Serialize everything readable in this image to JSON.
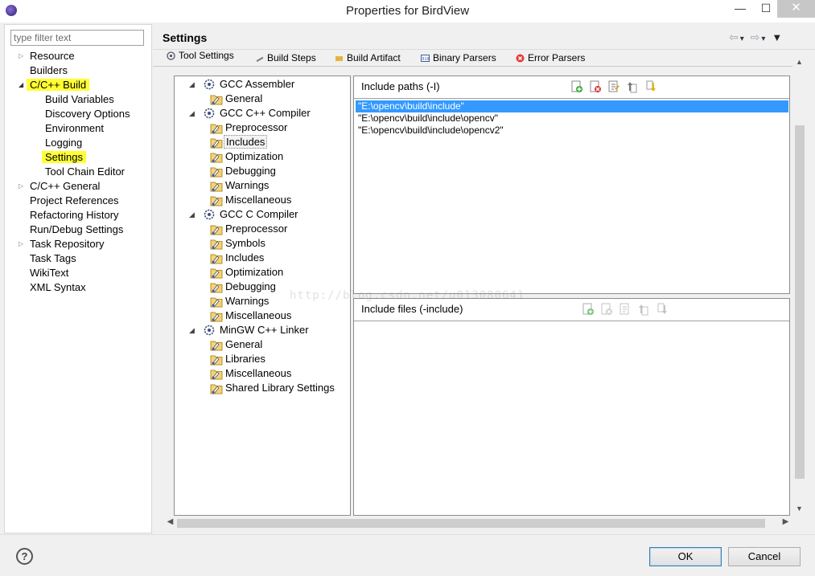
{
  "window": {
    "title": "Properties for BirdView",
    "min": "—",
    "max": "☐",
    "close": "✕"
  },
  "left_nav": {
    "filter_placeholder": "type filter text",
    "items": [
      {
        "label": "Resource",
        "expandable": true
      },
      {
        "label": "Builders"
      },
      {
        "label": "C/C++ Build",
        "expanded": true,
        "highlighted": true
      },
      {
        "label": "Build Variables"
      },
      {
        "label": "Discovery Options"
      },
      {
        "label": "Environment"
      },
      {
        "label": "Logging"
      },
      {
        "label": "Settings",
        "highlighted": true,
        "selected": true
      },
      {
        "label": "Tool Chain Editor"
      },
      {
        "label": "C/C++ General",
        "expandable": true
      },
      {
        "label": "Project References"
      },
      {
        "label": "Refactoring History"
      },
      {
        "label": "Run/Debug Settings"
      },
      {
        "label": "Task Repository",
        "expandable": true
      },
      {
        "label": "Task Tags"
      },
      {
        "label": "WikiText"
      },
      {
        "label": "XML Syntax"
      }
    ],
    "highlight_color": "#ffff33"
  },
  "page": {
    "title": "Settings"
  },
  "tabs": [
    {
      "label": "Tool Settings",
      "active": true,
      "icon": "tool-settings-icon"
    },
    {
      "label": "Build Steps",
      "icon": "build-steps-icon"
    },
    {
      "label": "Build Artifact",
      "icon": "build-artifact-icon"
    },
    {
      "label": "Binary Parsers",
      "icon": "binary-parsers-icon"
    },
    {
      "label": "Error Parsers",
      "icon": "error-parsers-icon"
    }
  ],
  "tool_tree": [
    {
      "label": "GCC Assembler",
      "options": [
        "General"
      ]
    },
    {
      "label": "GCC C++ Compiler",
      "options": [
        "Preprocessor",
        "Includes",
        "Optimization",
        "Debugging",
        "Warnings",
        "Miscellaneous"
      ]
    },
    {
      "label": "GCC C Compiler",
      "options": [
        "Preprocessor",
        "Symbols",
        "Includes",
        "Optimization",
        "Debugging",
        "Warnings",
        "Miscellaneous"
      ]
    },
    {
      "label": "MinGW C++ Linker",
      "options": [
        "General",
        "Libraries",
        "Miscellaneous",
        "Shared Library Settings"
      ]
    }
  ],
  "selected_option": "Includes",
  "include_paths": {
    "label": "Include paths (-I)",
    "items": [
      "\"E:\\opencv\\build\\include\"",
      "\"E:\\opencv\\build\\include\\opencv\"",
      "\"E:\\opencv\\build\\include\\opencv2\""
    ],
    "selected_index": 0
  },
  "include_files": {
    "label": "Include files (-include)",
    "items": []
  },
  "watermark": "http://blog.csdn.net/u013080641",
  "buttons": {
    "help": "?",
    "ok": "OK",
    "cancel": "Cancel"
  },
  "colors": {
    "selection": "#3399ff",
    "highlight": "#ffff33"
  }
}
